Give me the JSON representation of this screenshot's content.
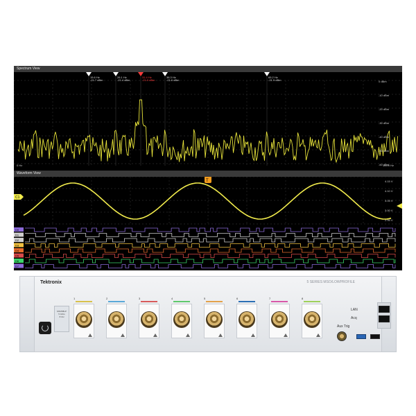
{
  "spectrum_view": {
    "title": "Spectrum View",
    "marker_labels": [
      {
        "freq": "15.6 Hz",
        "level": "-21.7 dBm"
      },
      {
        "freq": "26.1 Hz",
        "level": "-21.4 dBm"
      },
      {
        "freq": "31.4 Hz",
        "level": "-21.5 dBm"
      },
      {
        "freq": "38.3 Hz",
        "level": "-21.6 dBm"
      },
      {
        "freq": "65.2 Hz",
        "level": "-21.9 dBm"
      }
    ],
    "y_ticks": [
      "0 dBm",
      "-10 dBm",
      "-20 dBm",
      "-30 dBm",
      "-40 dBm",
      "-50 dBm",
      "-60 dBm"
    ],
    "x_start": "0 Hz",
    "x_end": "100.0 Hz"
  },
  "waveform_view": {
    "title": "Waveform View",
    "trigger_label": "T",
    "analog_label": "C1",
    "y_ticks": [
      "4.15 V",
      "4.10 V",
      "3.05 V",
      "3.00 V",
      "2.95 V"
    ],
    "digital_labels": [
      "D0",
      "D1",
      "D2",
      "D3",
      "D4",
      "D5",
      "D6",
      "D7"
    ]
  },
  "instrument": {
    "brand": "Tektronix",
    "product": "5 SERIES MSO/LOWPROFILE",
    "badge_lines": [
      "MSO58LP",
      "5 GS/s",
      "8 CH"
    ],
    "channels": [
      "1",
      "2",
      "3",
      "4",
      "5",
      "6",
      "7",
      "8"
    ],
    "channel_colors": [
      "#d8c14c",
      "#5aa8d8",
      "#d85a5a",
      "#5fc96b",
      "#e3a24a",
      "#2b6fb5",
      "#d857a8",
      "#9fd05a"
    ],
    "lan_label": "LAN",
    "acq_label": "Acq",
    "aux_trig_label": "Aux Trig",
    "usb_labels": [
      "USB",
      "USB"
    ]
  }
}
